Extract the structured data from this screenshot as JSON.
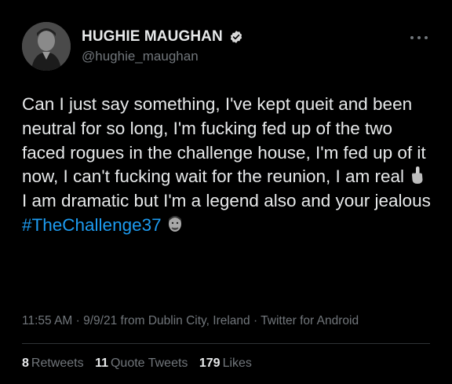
{
  "author": {
    "display_name": "HUGHIE MAUGHAN",
    "handle": "@hughie_maughan",
    "verified": true
  },
  "tweet": {
    "text_before_emoji": "Can I just say something, I've kept queit and been neutral for so long, I'm fucking fed up of the two faced rogues in the challenge house, I'm fed up of it now, I can't fucking wait for the reunion, I am real ",
    "text_after_emoji": " I am dramatic but I'm a legend also and your jealous ",
    "hashtag": "#TheChallenge37",
    "emoji_1": "middle-finger-icon",
    "emoji_2": "face-avatar-icon"
  },
  "meta": {
    "time": "11:55 AM",
    "separator": " · ",
    "date": "9/9/21",
    "location": "from Dublin City, Ireland",
    "source": "Twitter for Android"
  },
  "stats": {
    "retweets_count": "8",
    "retweets_label": "Retweets",
    "quotes_count": "11",
    "quotes_label": "Quote Tweets",
    "likes_count": "179",
    "likes_label": "Likes"
  },
  "colors": {
    "background": "#000000",
    "text": "#e7e9ea",
    "secondary": "#71767b",
    "link": "#1d9bf0",
    "verified": "#d9d9d9"
  }
}
